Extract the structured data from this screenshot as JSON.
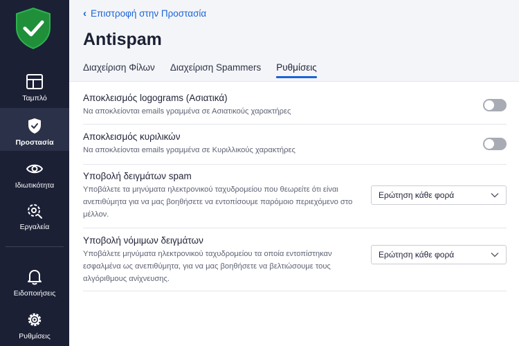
{
  "sidebar": {
    "items": [
      {
        "label": "Ταμπλό",
        "icon": "dashboard-icon"
      },
      {
        "label": "Προστασία",
        "icon": "shield-icon"
      },
      {
        "label": "Ιδιωτικότητα",
        "icon": "eye-icon"
      },
      {
        "label": "Εργαλεία",
        "icon": "tools-icon"
      },
      {
        "label": "Ειδοποιήσεις",
        "icon": "bell-icon"
      },
      {
        "label": "Ρυθμίσεις",
        "icon": "gear-icon"
      }
    ],
    "active": "Προστασία"
  },
  "header": {
    "back_label": "Επιστροφή στην Προστασία",
    "title": "Antispam",
    "tabs": [
      {
        "label": "Διαχείριση Φίλων"
      },
      {
        "label": "Διαχείριση Spammers"
      },
      {
        "label": "Ρυθμίσεις"
      }
    ],
    "active_tab": "Ρυθμίσεις"
  },
  "settings": [
    {
      "title": "Αποκλεισμός logograms (Ασιατικά)",
      "description": "Να αποκλείονται emails γραμμένα σε Ασιατικούς χαρακτήρες",
      "control": "toggle",
      "enabled": false
    },
    {
      "title": "Αποκλεισμός κυριλικών",
      "description": "Να αποκλείονται emails γραμμένα σε Κυριλλικούς χαρακτήρες",
      "control": "toggle",
      "enabled": false
    },
    {
      "title": "Υποβολή δειγμάτων spam",
      "description": "Υποβάλετε τα μηνύματα ηλεκτρονικού ταχυδρομείου που θεωρείτε ότι είναι ανεπιθύμητα για να μας βοηθήσετε να εντοπίσουμε παρόμοιο περιεχόμενο στο μέλλον.",
      "control": "select",
      "value": "Ερώτηση κάθε φορά"
    },
    {
      "title": "Υποβολή νόμιμων δειγμάτων",
      "description": "Υποβάλετε μηνύματα ηλεκτρονικού ταχυδρομείου τα οποία εντοπίστηκαν εσφαλμένα ως ανεπιθύμητα, για να μας βοηθήσετε να βελτιώσουμε τους αλγόριθμους ανίχνευσης.",
      "control": "select",
      "value": "Ερώτηση κάθε φορά"
    }
  ],
  "colors": {
    "sidebar_bg": "#1b2035",
    "accent": "#1a63d6",
    "logo_green": "#1f8f3a"
  }
}
